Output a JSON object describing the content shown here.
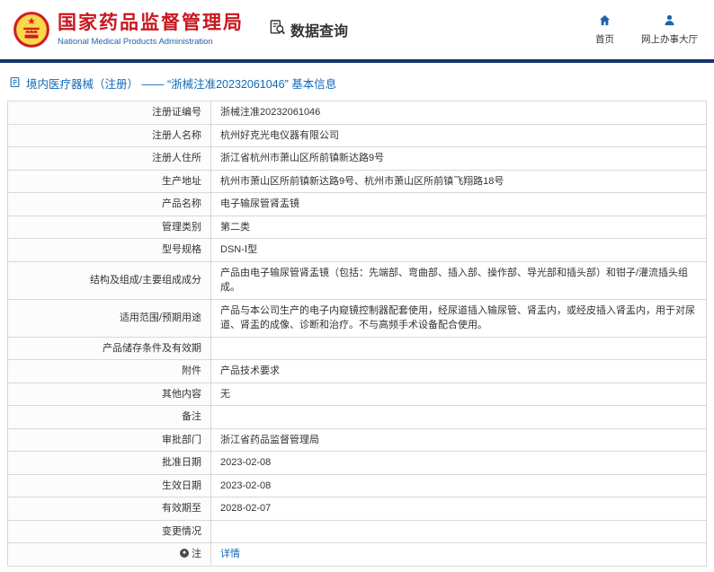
{
  "header": {
    "agency_cn": "国家药品监督管理局",
    "agency_en": "National Medical Products Administration",
    "data_query_label": "数据查询",
    "nav": [
      {
        "label": "首页",
        "icon": "home-icon"
      },
      {
        "label": "网上办事大厅",
        "icon": "person-icon"
      }
    ]
  },
  "colors": {
    "brand_red": "#c9161e",
    "brand_blue": "#1f63af",
    "navy_bar": "#15336e",
    "link_blue": "#0e69b8"
  },
  "breadcrumb": {
    "icon": "document-icon",
    "text": "境内医疗器械（注册） —— “浙械注准20232061046” 基本信息"
  },
  "table": {
    "rows": [
      {
        "label": "注册证编号",
        "value": "浙械注准20232061046"
      },
      {
        "label": "注册人名称",
        "value": "杭州好克光电仪器有限公司"
      },
      {
        "label": "注册人住所",
        "value": "浙江省杭州市萧山区所前镇新达路9号"
      },
      {
        "label": "生产地址",
        "value": "杭州市萧山区所前镇新达路9号、杭州市萧山区所前镇飞翔路18号"
      },
      {
        "label": "产品名称",
        "value": "电子输尿管肾盂镜"
      },
      {
        "label": "管理类别",
        "value": "第二类"
      },
      {
        "label": "型号规格",
        "value": "DSN-Ⅰ型"
      },
      {
        "label": "结构及组成/主要组成成分",
        "value": "产品由电子输尿管肾盂镜（包括：先端部、弯曲部、插入部、操作部、导光部和插头部）和钳子/灌流插头组成。"
      },
      {
        "label": "适用范围/预期用途",
        "value": "产品与本公司生产的电子内窥镜控制器配套使用，经尿道插入输尿管、肾盂内，或经皮插入肾盂内，用于对尿道、肾盂的成像、诊断和治疗。不与高频手术设备配合使用。"
      },
      {
        "label": "产品储存条件及有效期",
        "value": ""
      },
      {
        "label": "附件",
        "value": "产品技术要求"
      },
      {
        "label": "其他内容",
        "value": "无"
      },
      {
        "label": "备注",
        "value": ""
      },
      {
        "label": "审批部门",
        "value": "浙江省药品监督管理局"
      },
      {
        "label": "批准日期",
        "value": "2023-02-08"
      },
      {
        "label": "生效日期",
        "value": "2023-02-08"
      },
      {
        "label": "有效期至",
        "value": "2028-02-07"
      },
      {
        "label": "变更情况",
        "value": ""
      },
      {
        "label": "注",
        "label_icon": "note-icon",
        "value": "详情",
        "is_link": true
      }
    ]
  }
}
